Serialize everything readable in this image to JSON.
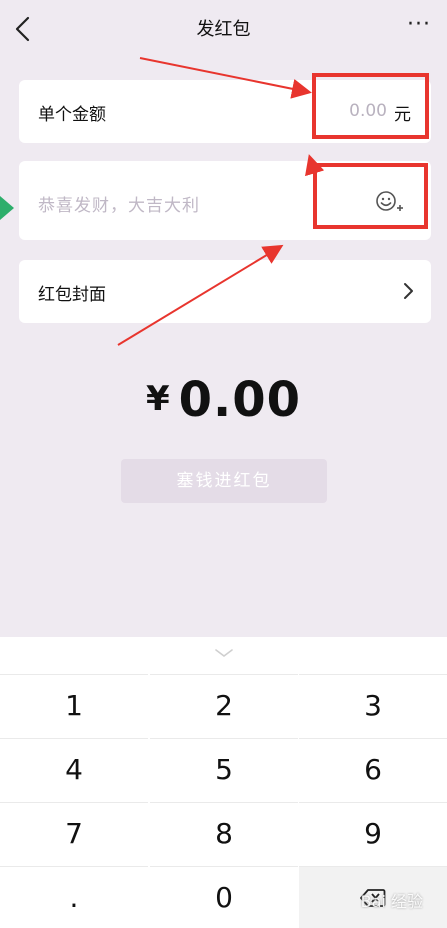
{
  "header": {
    "title": "发红包",
    "more": "···"
  },
  "amount_row": {
    "label": "单个金额",
    "value": "0.00",
    "unit": "元"
  },
  "greeting_row": {
    "placeholder": "恭喜发财，大吉大利"
  },
  "cover_row": {
    "label": "红包封面"
  },
  "total": {
    "currency": "¥",
    "value": "0.00"
  },
  "primary_button": {
    "label": "塞钱进红包"
  },
  "keyboard": {
    "keys": [
      "1",
      "2",
      "3",
      "4",
      "5",
      "6",
      "7",
      "8",
      "9",
      ".",
      "0"
    ]
  },
  "watermark": "Bai 经验",
  "colors": {
    "background": "#efeaf1",
    "annotation": "#e8352e",
    "button_disabled": "#e4dce7"
  }
}
